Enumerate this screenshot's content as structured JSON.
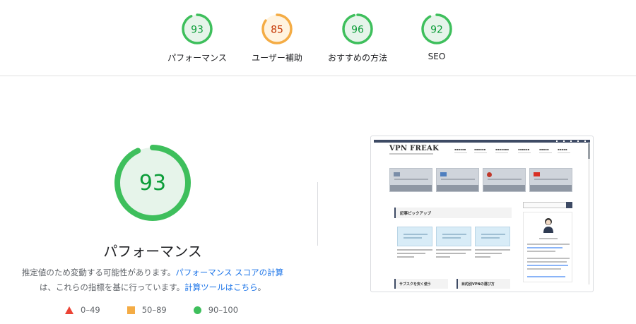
{
  "top_gauges": [
    {
      "score": 93,
      "label": "パフォーマンス",
      "color": "#0c9d39",
      "fill": "#3ebf5c",
      "bg": "#e6f4ea"
    },
    {
      "score": 85,
      "label": "ユーザー補助",
      "color": "#c33300",
      "fill": "#f4ac45",
      "bg": "#fff3e0"
    },
    {
      "score": 96,
      "label": "おすすめの方法",
      "color": "#0c9d39",
      "fill": "#3ebf5c",
      "bg": "#e6f4ea"
    },
    {
      "score": 92,
      "label": "SEO",
      "color": "#0c9d39",
      "fill": "#3ebf5c",
      "bg": "#e6f4ea"
    }
  ],
  "main": {
    "score": 93,
    "title": "パフォーマンス",
    "desc_part1": "推定値のため変動する可能性があります。",
    "desc_link1": "パフォーマンス スコアの計算",
    "desc_part2": "は、これらの指標を基に行っています。",
    "desc_link2": "計算ツールはこちら",
    "desc_end": "。"
  },
  "legend": {
    "fail": "0–49",
    "average": "50–89",
    "pass": "90–100"
  },
  "thumbnail": {
    "logo": "VPN FREAK",
    "section_title": "記事ピックアップ",
    "sub1": "サブスクを安く使う",
    "sub2": "目的別VPNの選び方"
  },
  "colors": {
    "pass_text": "#0c9d39",
    "pass_fill": "#3ebf5c",
    "pass_bg": "#e6f4ea",
    "avg_fill": "#f4ac45",
    "fail_fill": "#eb4335",
    "link": "#1a73e8"
  }
}
